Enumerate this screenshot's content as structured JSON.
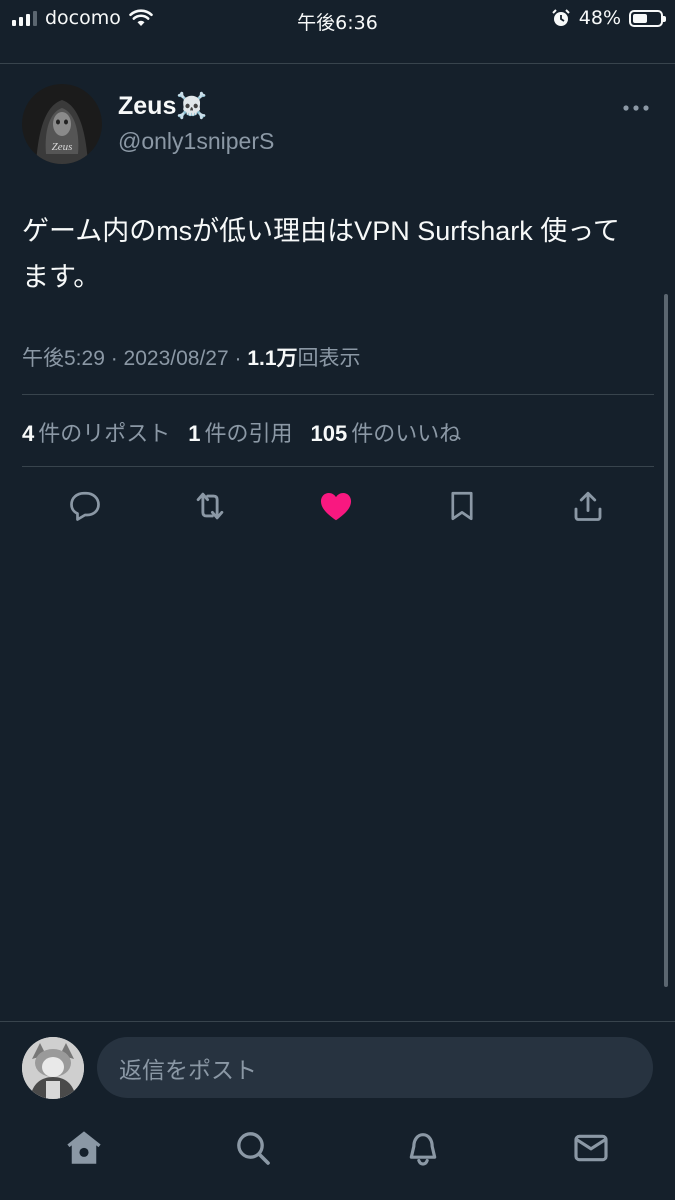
{
  "status_bar": {
    "carrier": "docomo",
    "time": "午後6:36",
    "battery": "48%",
    "battery_level": 0.48
  },
  "tweet": {
    "author_name": "Zeus☠️",
    "author_handle": "@only1sniperS",
    "avatar_text": "Zeus",
    "text": "ゲーム内のmsが低い理由はVPN Surfshark 使ってます。",
    "timestamp": "午後5:29 · 2023/08/27 · ",
    "view_count": "1.1万",
    "view_label": "回表示",
    "reposts_count": "4",
    "reposts_label": "件のリポスト",
    "quotes_count": "1",
    "quotes_label": "件の引用",
    "likes_count": "105",
    "likes_label": "件のいいね",
    "liked": true
  },
  "reply": {
    "placeholder": "返信をポスト"
  },
  "colors": {
    "background": "#15202b",
    "like": "#f91880",
    "muted": "#8b98a5"
  },
  "icons": {
    "actions": [
      "reply-icon",
      "retweet-icon",
      "heart-icon",
      "bookmark-icon",
      "share-icon"
    ],
    "tabs": [
      "home-icon",
      "search-icon",
      "bell-icon",
      "mail-icon"
    ]
  }
}
